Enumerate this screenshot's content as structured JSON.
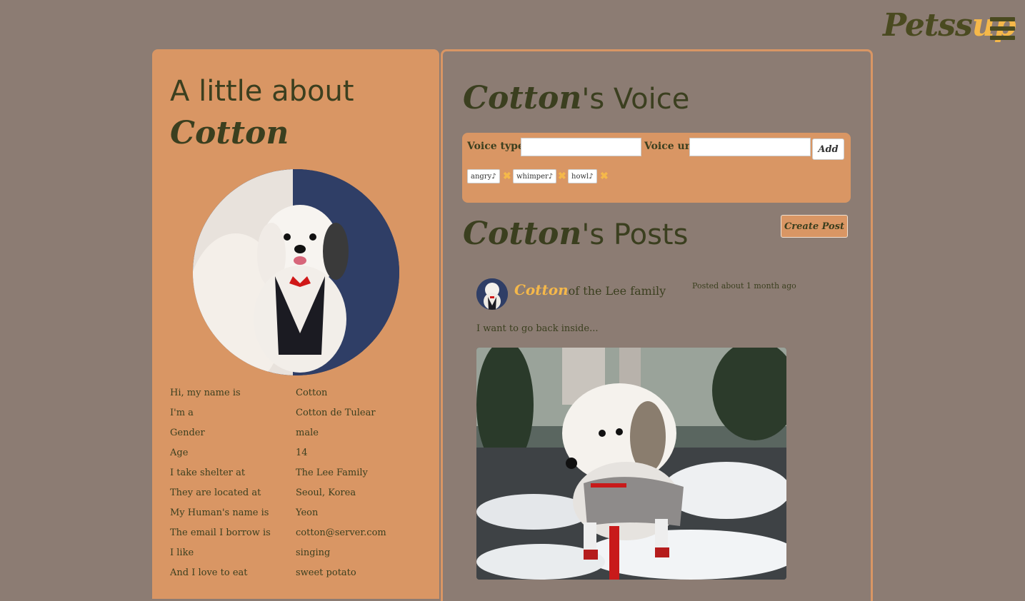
{
  "header": {
    "logo_main": "Petss",
    "logo_accent": "up"
  },
  "about": {
    "title": "A little about",
    "name": "Cotton",
    "rows": [
      {
        "label": "Hi, my name is",
        "value": "Cotton"
      },
      {
        "label": "I'm a",
        "value": "Cotton de Tulear"
      },
      {
        "label": "Gender",
        "value": "male"
      },
      {
        "label": "Age",
        "value": "14"
      },
      {
        "label": "I take shelter at",
        "value": "The Lee Family"
      },
      {
        "label": "They are located at",
        "value": "Seoul, Korea"
      },
      {
        "label": "My Human's name is",
        "value": "Yeon"
      },
      {
        "label": "The email I borrow is",
        "value": "cotton@server.com"
      },
      {
        "label": "I like",
        "value": "singing"
      },
      {
        "label": "And I love to eat",
        "value": "sweet potato"
      }
    ]
  },
  "voice": {
    "title_name": "Cotton",
    "title_rest": "'s Voice",
    "type_label": "Voice type",
    "url_label": "Voice url",
    "type_value": "",
    "url_value": "",
    "add_label": "Add",
    "tags": [
      "angry♪",
      "whimper♪",
      "howl♪"
    ]
  },
  "posts": {
    "title_name": "Cotton",
    "title_rest": "'s Posts",
    "create_label": "Create Post",
    "items": [
      {
        "author": "Cotton",
        "family": "of the Lee family",
        "time": "Posted about 1 month ago",
        "text": "I want to go back inside..."
      }
    ]
  },
  "colors": {
    "background": "#8c7c73",
    "panel": "#d99664",
    "accent": "#f5b84a",
    "text": "#3b3f1f"
  }
}
